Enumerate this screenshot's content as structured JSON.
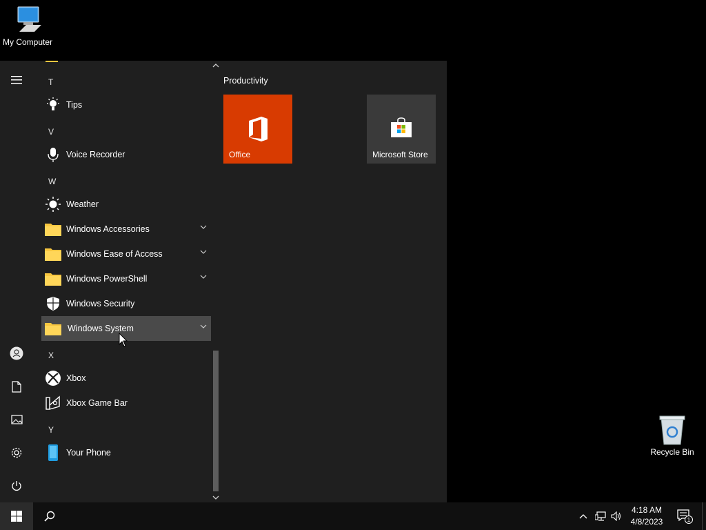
{
  "desktop": {
    "icons": [
      {
        "label": "My Computer",
        "icon": "computer-icon"
      },
      {
        "label": "Recycle Bin",
        "icon": "recycle-bin-icon"
      }
    ]
  },
  "start_menu": {
    "rail": [
      {
        "icon": "hamburger-menu-icon"
      },
      {
        "icon": "user-account-icon"
      },
      {
        "icon": "documents-icon"
      },
      {
        "icon": "pictures-icon"
      },
      {
        "icon": "settings-gear-icon"
      },
      {
        "icon": "power-icon"
      }
    ],
    "letters": {
      "t": "T",
      "v": "V",
      "w": "W",
      "x": "X",
      "y": "Y"
    },
    "apps": {
      "tips": "Tips",
      "voice_recorder": "Voice Recorder",
      "weather": "Weather",
      "windows_accessories": "Windows Accessories",
      "windows_ease_of_access": "Windows Ease of Access",
      "windows_powershell": "Windows PowerShell",
      "windows_security": "Windows Security",
      "windows_system": "Windows System",
      "xbox": "Xbox",
      "xbox_game_bar": "Xbox Game Bar",
      "your_phone": "Your Phone"
    },
    "hovered_app": "Windows System",
    "tiles": {
      "group_title": "Productivity",
      "office": "Office",
      "store": "Microsoft Store"
    }
  },
  "taskbar": {
    "time": "4:18 AM",
    "date": "4/8/2023",
    "notification_count": "1"
  },
  "colors": {
    "menu_bg": "#1f1f1f",
    "office_tile": "#d83b01",
    "store_tile": "#3a3a3a",
    "folder_yellow": "#f8c640",
    "hover_bg": "#4a4a4a"
  }
}
